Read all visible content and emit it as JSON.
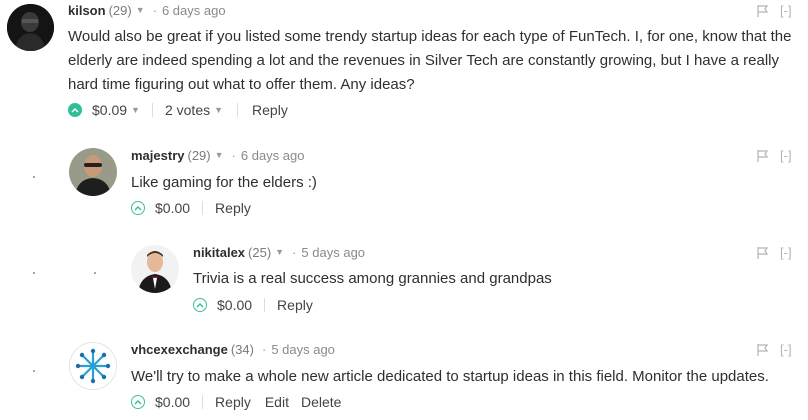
{
  "comments": [
    {
      "author": "kilson",
      "rep": "(29)",
      "time": "6 days ago",
      "text": "Would also be great if you listed some trendy startup ideas for each type of FunTech. I, for one, know that the elderly are indeed spending a lot and the revenues in Silver Tech are constantly growing, but I have a really hard time figuring out what to offer them. Any ideas?",
      "amount": "$0.09",
      "votes": "2 votes",
      "reply": "Reply",
      "collapse": "[-]"
    },
    {
      "author": "majestry",
      "rep": "(29)",
      "time": "6 days ago",
      "text": "Like gaming for the elders :)",
      "amount": "$0.00",
      "reply": "Reply",
      "collapse": "[-]"
    },
    {
      "author": "nikitalex",
      "rep": "(25)",
      "time": "5 days ago",
      "text": "Trivia is a real success among grannies and grandpas",
      "amount": "$0.00",
      "reply": "Reply",
      "collapse": "[-]"
    },
    {
      "author": "vhcexexchange",
      "rep": "(34)",
      "time": "5 days ago",
      "text": "We'll try to make a whole new article dedicated to startup ideas in this field. Monitor the updates.",
      "amount": "$0.00",
      "reply": "Reply",
      "edit": "Edit",
      "delete": "Delete",
      "collapse": "[-]"
    }
  ],
  "colors": {
    "upvote": "#2fc09a",
    "muted": "#8a8a8a"
  },
  "icons": [
    "upvote-icon",
    "flag-icon",
    "caret-down-icon"
  ]
}
